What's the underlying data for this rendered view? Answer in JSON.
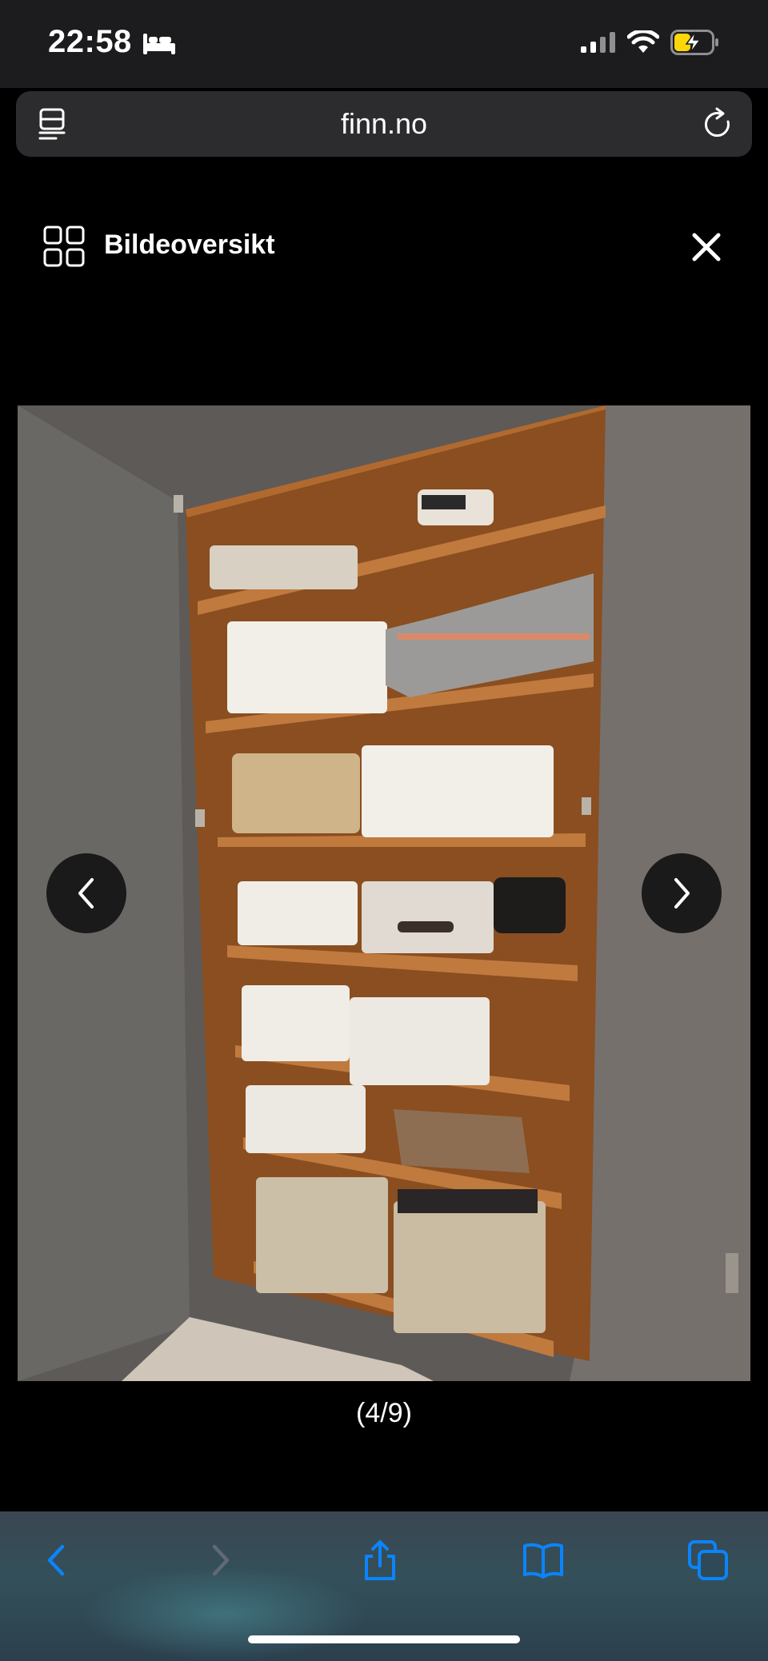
{
  "status_bar": {
    "time": "22:58",
    "icons": [
      "bed-icon",
      "cellular-signal-icon",
      "wifi-icon",
      "battery-charging-icon"
    ]
  },
  "browser": {
    "domain": "finn.no",
    "icons": [
      "reader-mode-icon",
      "reload-icon"
    ]
  },
  "gallery": {
    "header_title": "Bildeoversikt",
    "header_icon": "grid-overview-icon",
    "close_icon": "close-icon",
    "counter": "(4/9)",
    "prev_icon": "chevron-left-icon",
    "next_icon": "chevron-right-icon",
    "photo_subject": "wardrobe-with-shelves-photo"
  },
  "toolbar": {
    "icons": [
      "back-icon",
      "forward-icon",
      "share-icon",
      "bookmarks-icon",
      "tabs-icon"
    ]
  },
  "colors": {
    "status_bg": "#1c1c1e",
    "url_bar_bg": "#2c2c2e",
    "accent": "#0a84ff",
    "battery": "#ffd60a",
    "nav_button_bg": "#1a1a1a"
  }
}
